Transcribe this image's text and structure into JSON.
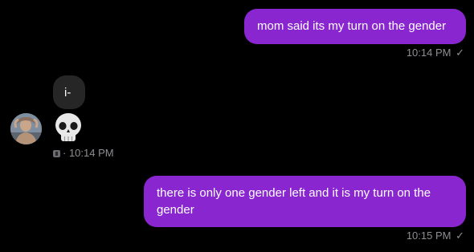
{
  "messages": [
    {
      "text": "mom said its my turn on the gender",
      "time": "10:14 PM",
      "status": "✓"
    },
    {
      "text": "i-",
      "emoji": "skull",
      "time": "10:14 PM"
    },
    {
      "text": "there is only one gender left and it is my turn on the gender",
      "time": "10:15 PM",
      "status": "✓"
    }
  ],
  "colors": {
    "outgoing_bubble": "#8a26cf",
    "incoming_bubble": "#262626",
    "background": "#000000",
    "meta_text": "#8e8e93"
  },
  "icons": {
    "status": "check-icon",
    "reaction": "skull-emoji",
    "meta_prefix": "message-info-icon"
  }
}
